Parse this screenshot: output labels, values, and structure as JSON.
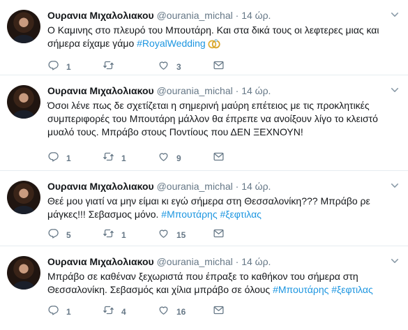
{
  "tweets": [
    {
      "author": "Ουρανια Μιχαλολιακου",
      "handle": "@ourania_michal",
      "separator": "·",
      "time": "14 ώρ.",
      "text": "Ο Καμινης στο πλευρό του Μπουτάρη. Και στα δικά τους οι λεφτερες μιας και σήμερα είχαμε γάμο ",
      "hashtags": "#RoyalWedding",
      "emoji": "wedding-rings",
      "replies": "1",
      "retweets": "",
      "likes": "3"
    },
    {
      "author": "Ουρανια Μιχαλολιακου",
      "handle": "@ourania_michal",
      "separator": "·",
      "time": "14 ώρ.",
      "text": "Όσοι λένε πως δε σχετίζεται η σημερινή μαύρη επέτειος με τις προκλητικές συμπεριφορές του Μπουτάρη μάλλον θα έπρεπε να ανοίξουν λίγο το κλειστό μυαλό τους. Μπράβο στους Ποντίους που ΔΕΝ ΞΕΧΝΟΥΝ!",
      "hashtags": "",
      "replies": "1",
      "retweets": "1",
      "likes": "9"
    },
    {
      "author": "Ουρανια Μιχαλολιακου",
      "handle": "@ourania_michal",
      "separator": "·",
      "time": "14 ώρ.",
      "text": "Θεέ μου γιατί να μην είμαι κι εγώ σήμερα στη Θεσσαλονίκη??? Μπράβο ρε μάγκες!!! Σεβασμος μόνο.  ",
      "hashtags": "#Μπουτάρης #ξεφτιλας",
      "replies": "5",
      "retweets": "1",
      "likes": "15"
    },
    {
      "author": "Ουρανια Μιχαλολιακου",
      "handle": "@ourania_michal",
      "separator": "·",
      "time": "14 ώρ.",
      "text": "Μπράβο σε καθέναν ξεχωριστά που έπραξε το καθήκον του σήμερα στη Θεσσαλονίκη. Σεβασμός και χίλια μπράβο σε όλους ",
      "hashtags": "#Μπουτάρης #ξεφτιλας",
      "replies": "1",
      "retweets": "4",
      "likes": "16"
    }
  ],
  "icons": {
    "reply": "reply-icon",
    "retweet": "retweet-icon",
    "like": "heart-icon",
    "dm": "envelope-icon",
    "caret": "chevron-down-icon"
  },
  "colors": {
    "link": "#1b95e0",
    "muted": "#657786",
    "border": "#e6ecf0"
  }
}
